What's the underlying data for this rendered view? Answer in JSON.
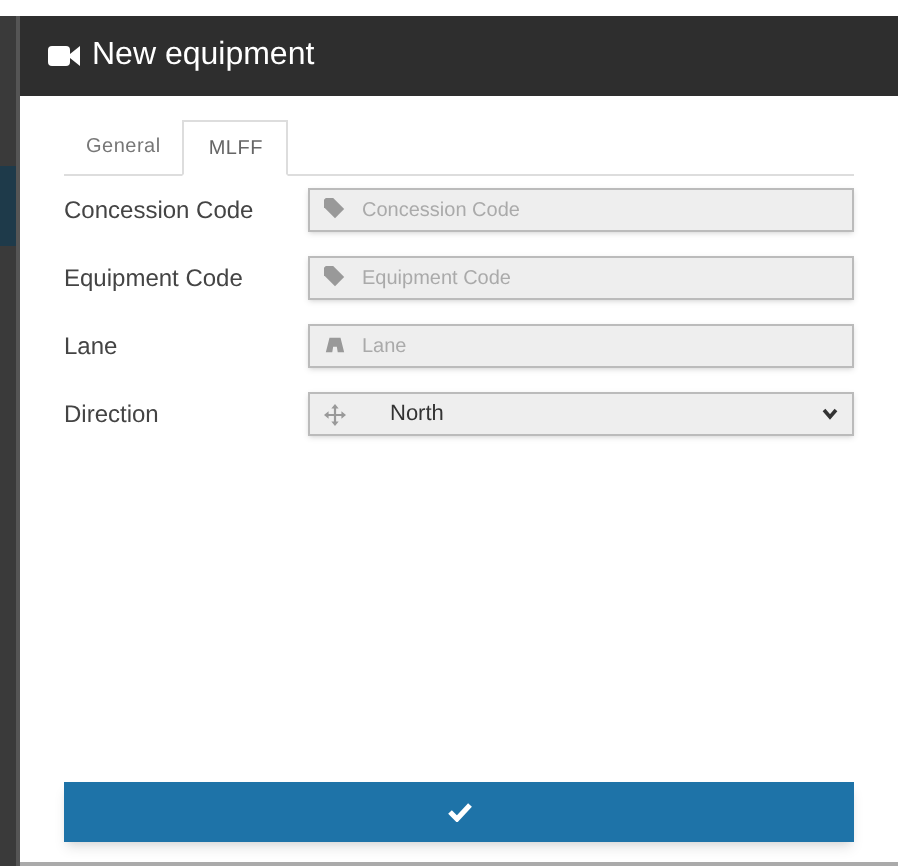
{
  "dialog": {
    "title": "New equipment"
  },
  "tabs": [
    {
      "label": "General",
      "selected": false
    },
    {
      "label": "MLFF",
      "selected": true
    }
  ],
  "fields": [
    {
      "kind": "tag",
      "label": "Concession Code",
      "placeholder": "Concession Code"
    },
    {
      "kind": "tag",
      "label": "Equipment Code",
      "placeholder": "Equipment Code"
    },
    {
      "kind": "road",
      "label": "Lane",
      "placeholder": "Lane"
    },
    {
      "kind": "select",
      "label": "Direction",
      "value": "North"
    }
  ]
}
